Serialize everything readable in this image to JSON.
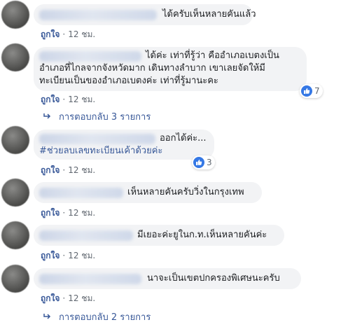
{
  "comments": [
    {
      "text_lines": [
        "ได้ครับเห็นหลายคันแล้ว"
      ],
      "like_label": "ถูกใจ",
      "time": "12 ชม."
    },
    {
      "text_lines": [
        "ได้ค่ะ เท่าที่รู้ว่า คืออำเภอเบตงเป็น",
        "อำเภอที่ไกลจากจังหวัดมาก เดินทางลำบาก เขาเลยจัดให้มี",
        "ทะเบียนเป็นของอำเภอเบตงค่ะ เท่าที่รู้มานะคะ"
      ],
      "like_label": "ถูกใจ",
      "time": "12 ชม.",
      "reaction_count": "7",
      "replies_label": "การตอบกลับ 3 รายการ"
    },
    {
      "text_lines": [
        "ออกได้ค่ะ..."
      ],
      "hashtag": "#ช่วยลบเลขทะเบียนเค้าด้วยค่ะ",
      "like_label": "ถูกใจ",
      "time": "12 ชม.",
      "reaction_count": "3"
    },
    {
      "text_lines": [
        "เห็นหลายคันครับวิ่งในกรุงเทพ"
      ],
      "like_label": "ถูกใจ",
      "time": "12 ชม."
    },
    {
      "text_lines": [
        "มีเยอะค่ะยูในก.ท.เห็นหลายคันค่ะ"
      ],
      "like_label": "ถูกใจ",
      "time": "12 ชม."
    },
    {
      "text_lines": [
        "นาจะเป็นเขตปกครองพิเศษนะครับ"
      ],
      "like_label": "ถูกใจ",
      "time": "12 ชม.",
      "replies_label": "การตอบกลับ 2 รายการ"
    }
  ],
  "separator": "·",
  "colors": {
    "link": "#385898",
    "bubble": "#f2f3f5",
    "like_icon": "#3578e5"
  }
}
